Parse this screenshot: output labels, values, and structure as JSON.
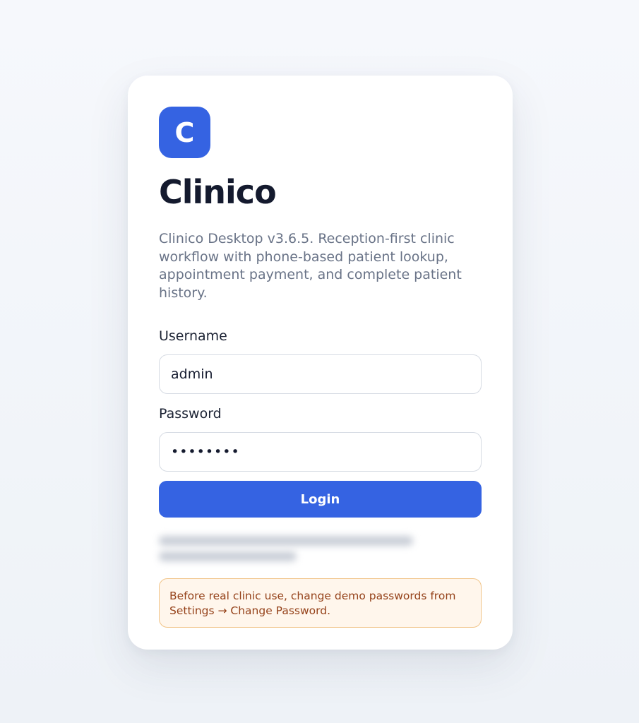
{
  "app": {
    "logo_letter": "C",
    "title": "Clinico",
    "subtitle": "Clinico Desktop v3.6.5. Reception-first clinic workflow with phone-based patient lookup, appointment payment, and complete patient history."
  },
  "form": {
    "username_label": "Username",
    "username_value": "admin",
    "password_label": "Password",
    "password_value": "••••••••",
    "login_label": "Login"
  },
  "notice": {
    "warning_text": "Before real clinic use, change demo passwords from Settings → Change Password."
  },
  "colors": {
    "accent": "#3563e2",
    "warning_border": "#f1c488",
    "warning_bg": "#fff6ec",
    "warning_text": "#95421a"
  }
}
